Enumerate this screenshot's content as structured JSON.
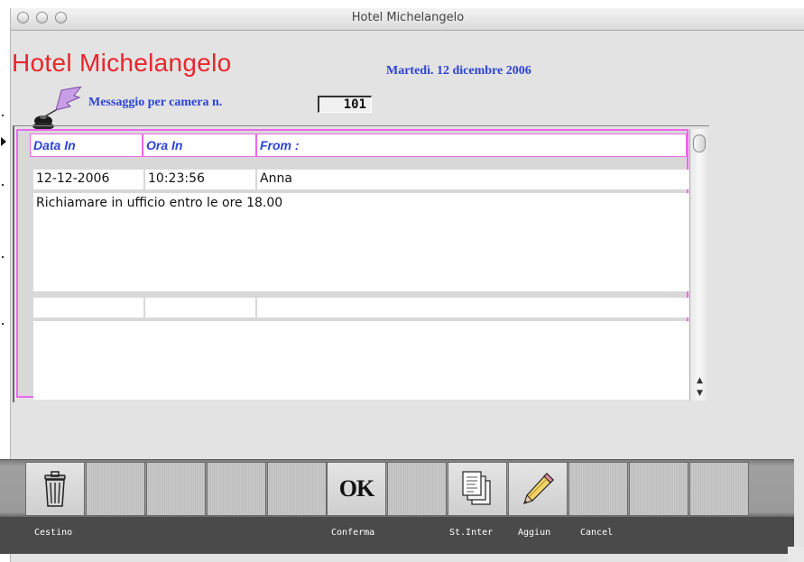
{
  "window": {
    "title": "Hotel Michelangelo"
  },
  "header": {
    "hotel_name": "Hotel Michelangelo",
    "date": "Martedì. 12 dicembre 2006",
    "message_label": "Messaggio per  camera n.",
    "room_number": "101"
  },
  "table": {
    "columns": [
      "Data In",
      "Ora In",
      "From :"
    ],
    "records": [
      {
        "date": "12-12-2006",
        "time": "10:23:56",
        "from": "Anna",
        "message": "Richiamare in ufficio entro le ore 18.00"
      },
      {
        "date": "",
        "time": "",
        "from": "",
        "message": ""
      }
    ]
  },
  "toolbar": {
    "labels": {
      "cestino": "Cestino",
      "conferma": "Conferma",
      "stinter": "St.Inter",
      "aggiun": "Aggiun",
      "cancel": "Cancel"
    },
    "ok_text": "OK"
  },
  "icons": [
    "inkwell-quill-icon",
    "trash-can-icon",
    "ok-icon",
    "documents-icon",
    "pencil-icon"
  ],
  "colors": {
    "hotel_title": "#e8262b",
    "label_blue": "#2c43d4",
    "table_border": "#ee66ee"
  }
}
